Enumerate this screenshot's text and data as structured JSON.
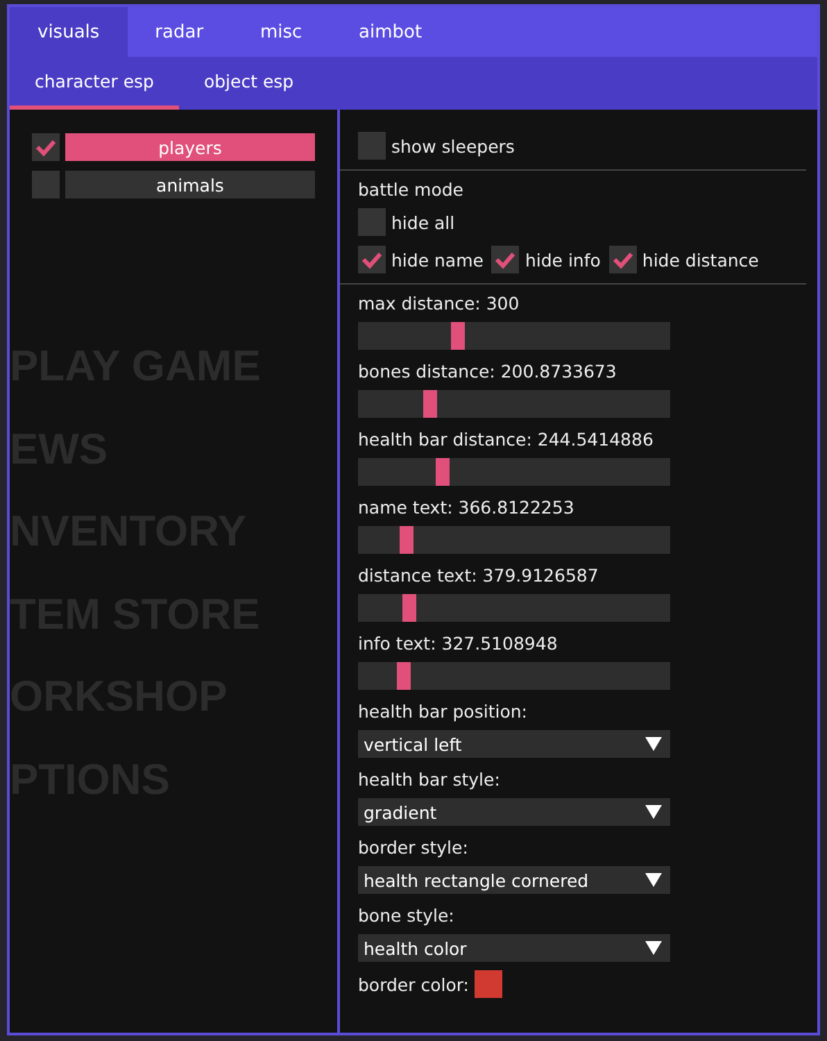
{
  "background_menu": [
    "PLAY GAME",
    "EWS",
    "NVENTORY",
    "TEM STORE",
    "ORKSHOP",
    "PTIONS"
  ],
  "tabs": [
    {
      "label": "visuals",
      "selected": true
    },
    {
      "label": "radar",
      "selected": false
    },
    {
      "label": "misc",
      "selected": false
    },
    {
      "label": "aimbot",
      "selected": false
    }
  ],
  "subtabs": [
    {
      "label": "character esp",
      "selected": true
    },
    {
      "label": "object esp",
      "selected": false
    }
  ],
  "targets": [
    {
      "label": "players",
      "checked": true,
      "selected": true
    },
    {
      "label": "animals",
      "checked": false,
      "selected": false
    }
  ],
  "settings": [
    {
      "kind": "checkbox",
      "label": "show sleepers",
      "checked": false
    },
    {
      "kind": "divider"
    },
    {
      "kind": "heading",
      "label": "battle mode"
    },
    {
      "kind": "checkbox",
      "label": "hide all",
      "checked": false
    },
    {
      "kind": "checkrow",
      "items": [
        {
          "label": "hide name",
          "checked": true
        },
        {
          "label": "hide info",
          "checked": true
        },
        {
          "label": "hide distance",
          "checked": true
        }
      ]
    },
    {
      "kind": "divider"
    },
    {
      "kind": "slider",
      "label": "max distance: 300",
      "level": 0.31
    },
    {
      "kind": "slider",
      "label": "bones distance: 200.8733673",
      "level": 0.22
    },
    {
      "kind": "slider",
      "label": "health bar distance: 244.5414886",
      "level": 0.26
    },
    {
      "kind": "slider",
      "label": "name text: 366.8122253",
      "level": 0.14
    },
    {
      "kind": "slider",
      "label": "distance text: 379.9126587",
      "level": 0.15
    },
    {
      "kind": "slider",
      "label": "info text: 327.5108948",
      "level": 0.13
    },
    {
      "kind": "dropdown",
      "label": "health bar position:",
      "value": "vertical left"
    },
    {
      "kind": "dropdown",
      "label": "health bar style:",
      "value": "gradient"
    },
    {
      "kind": "dropdown",
      "label": "border style:",
      "value": "health rectangle cornered"
    },
    {
      "kind": "dropdown",
      "label": "bone style:",
      "value": "health color"
    },
    {
      "kind": "color",
      "label": "border color:",
      "color": "#d03a30"
    }
  ]
}
